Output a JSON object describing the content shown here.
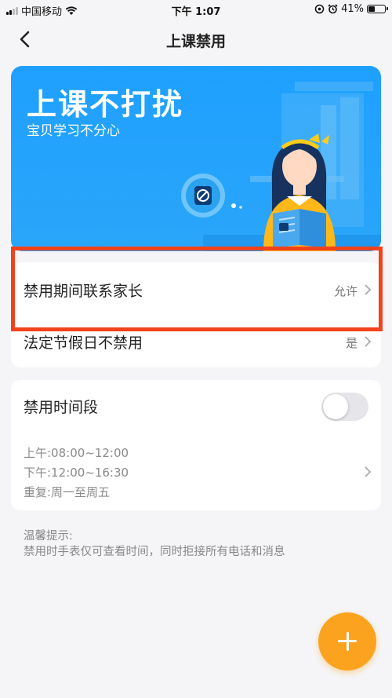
{
  "status_bar": {
    "carrier": "中国移动",
    "time": "下午 1:07",
    "battery": "41%",
    "battery_level": 0.41
  },
  "nav": {
    "title": "上课禁用"
  },
  "banner": {
    "title": "上课不打扰",
    "subtitle": "宝贝学习不分心"
  },
  "settings": {
    "contact_parents": {
      "label": "禁用期间联系家长",
      "value": "允许"
    },
    "holidays": {
      "label": "法定节假日不禁用",
      "value": "是"
    }
  },
  "schedule": {
    "title": "禁用时间段",
    "toggle_on": false,
    "morning": "上午:08:00~12:00",
    "afternoon": "下午:12:00~16:30",
    "repeat": "重复:周一至周五"
  },
  "tips": {
    "title": "温馨提示:",
    "text": "禁用时手表仅可查看时间，同时拒接所有电话和消息"
  },
  "colors": {
    "banner_blue": "#1fa0ff",
    "highlight_red": "#f2421c",
    "fab_orange": "#fba31e"
  }
}
